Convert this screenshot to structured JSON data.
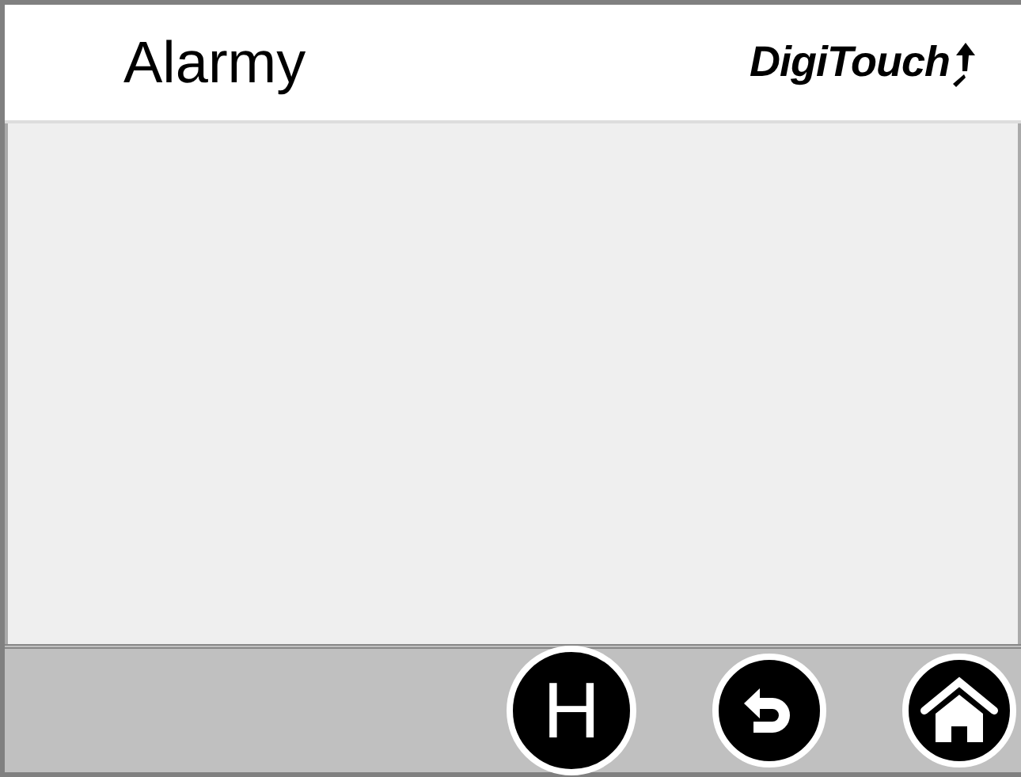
{
  "header": {
    "title": "Alarmy",
    "logo": "DigiTouch"
  },
  "footer": {
    "buttons": [
      {
        "kind": "letter",
        "label": "H"
      },
      {
        "kind": "back"
      },
      {
        "kind": "home"
      }
    ]
  }
}
